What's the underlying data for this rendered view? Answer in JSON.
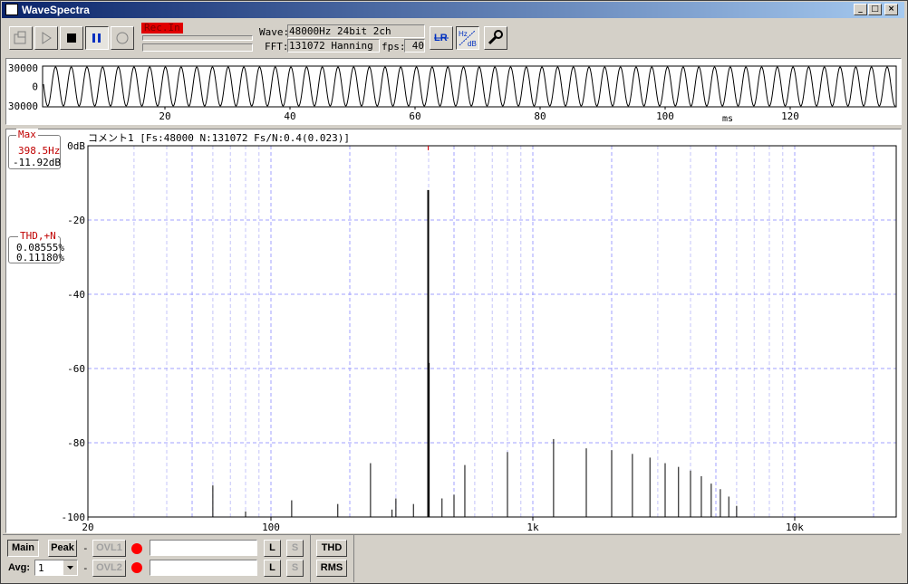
{
  "window": {
    "title": "WaveSpectra",
    "min": "_",
    "max": "□",
    "close": "×"
  },
  "toolbar": {
    "rec_in": "Rec.In",
    "wave_label": "Wave:",
    "wave_value": "48000Hz 24bit 2ch",
    "fft_label": "FFT:",
    "fft_value": "131072 Hanning",
    "fps_label": "fps:",
    "fps_value": "40",
    "lr_label": "LR",
    "hz_label": "Hz",
    "db_label": "dB"
  },
  "wave": {
    "y_ticks": [
      "30000",
      "0",
      "-30000"
    ],
    "x_ticks": [
      "20",
      "40",
      "60",
      "80",
      "100",
      "120"
    ],
    "x_unit": "ms"
  },
  "spectrum": {
    "comment": "コメント1  [Fs:48000 N:131072 Fs/N:0.4(0.023)]",
    "y_ticks": [
      "0dB",
      "-20",
      "-40",
      "-60",
      "-80",
      "-100"
    ],
    "x_ticks": [
      "20",
      "100",
      "1k",
      "10k"
    ]
  },
  "max_box": {
    "title": "Max",
    "freq": "398.5Hz",
    "level": "-11.92dB"
  },
  "thd_box": {
    "title": "THD,+N",
    "thd": "0.08555%",
    "thdn": "0.11180%"
  },
  "bottom": {
    "main": "Main",
    "peak": "Peak",
    "dash1": "-",
    "dash2": "-",
    "ovl1": "OVL1",
    "ovl2": "OVL2",
    "L1": "L",
    "S1": "S",
    "L2": "L",
    "S2": "S",
    "avg_label": "Avg:",
    "avg_value": "1",
    "thd": "THD",
    "rms": "RMS"
  },
  "chart_data": {
    "type": "bar",
    "title": "",
    "x_scale": "log",
    "xlim": [
      20,
      24000
    ],
    "ylim": [
      -100,
      0
    ],
    "ylabel": "dB",
    "series": [
      {
        "x": [
          60,
          80,
          120,
          180,
          240,
          290,
          300,
          350,
          398.5,
          402,
          450,
          500,
          550,
          800,
          1200,
          1600,
          2000,
          2400,
          2800,
          3200,
          3600,
          4000,
          4400,
          4800,
          5200,
          5600,
          6000
        ],
        "y": [
          -91.5,
          -98.5,
          -95.5,
          -96.5,
          -85.5,
          -98,
          -95,
          -96.5,
          -11.92,
          -58.5,
          -95,
          -94,
          -86,
          -82.5,
          -79,
          -81.5,
          -82,
          -83,
          -84,
          -85.5,
          -86.5,
          -87.5,
          -89,
          -91,
          -92.5,
          -94.5,
          -97
        ]
      }
    ]
  }
}
